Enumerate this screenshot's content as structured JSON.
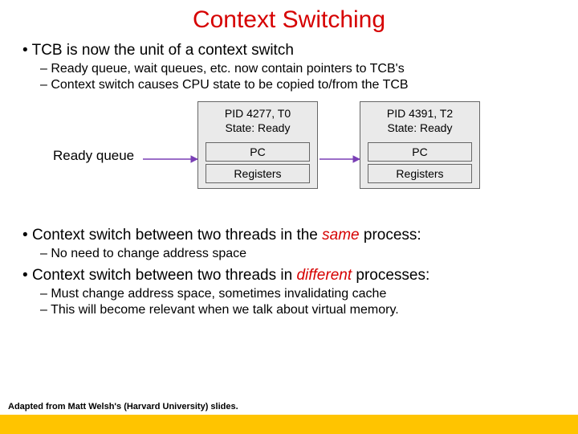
{
  "title": "Context Switching",
  "bullets": {
    "b1": "TCB is now the unit of a context switch",
    "b1s1": "Ready queue, wait queues, etc. now contain pointers to TCB's",
    "b1s2": "Context switch causes CPU state to be copied to/from the TCB",
    "b2_pre": "Context switch between two threads in the ",
    "b2_em": "same",
    "b2_post": " process:",
    "b2s1": "No need to change address space",
    "b3_pre": "Context switch between two threads in ",
    "b3_em": "different",
    "b3_post": " processes:",
    "b3s1": "Must change address space, sometimes invalidating cache",
    "b3s2": "This will become relevant when we talk about virtual memory."
  },
  "diagram": {
    "ready_label": "Ready queue",
    "tcb1": {
      "line1": "PID 4277, T0",
      "line2": "State: Ready",
      "pc": "PC",
      "regs": "Registers"
    },
    "tcb2": {
      "line1": "PID 4391, T2",
      "line2": "State: Ready",
      "pc": "PC",
      "regs": "Registers"
    }
  },
  "footer": "Adapted from Matt Welsh's (Harvard University) slides."
}
